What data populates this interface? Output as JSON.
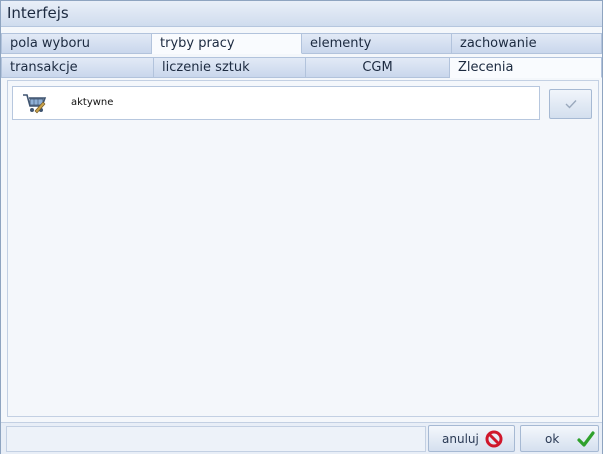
{
  "window": {
    "title": "Interfejs"
  },
  "tabs": {
    "row1": [
      "pola wyboru",
      "tryby pracy",
      "elementy",
      "zachowanie"
    ],
    "row2": [
      "transakcje",
      "liczenie sztuk",
      "CGM",
      "Zlecenia"
    ]
  },
  "content": {
    "item": {
      "label": "aktywne",
      "icon": "cart-icon"
    },
    "confirm_icon": "check-icon"
  },
  "footer": {
    "cancel_label": "anuluj",
    "ok_label": "ok",
    "colors": {
      "cancel": "#d0172b",
      "ok": "#2fa12c"
    }
  }
}
